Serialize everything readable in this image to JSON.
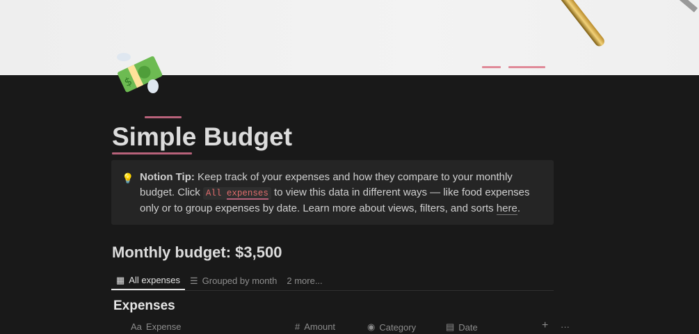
{
  "page": {
    "title": "Simple Budget",
    "icon": "money-with-wings-icon"
  },
  "callout": {
    "icon": "lightbulb-icon",
    "bold": "Notion Tip:",
    "text1": " Keep track of your expenses and how they compare to your monthly budget. Click ",
    "code_a": "All",
    "code_b": "expenses",
    "text2": " to view this data in different ways — like food expenses only or to group expenses by date. Learn more about views, filters, and sorts ",
    "link": "here",
    "text3": "."
  },
  "budget_heading": "Monthly budget: $3,500",
  "tabs": [
    {
      "label": "All expenses",
      "icon": "table-icon"
    },
    {
      "label": "Grouped by month",
      "icon": "list-icon"
    },
    {
      "label": "2 more..."
    }
  ],
  "database": {
    "title": "Expenses",
    "columns": [
      {
        "label": "Expense",
        "icon": "Aa"
      },
      {
        "label": "Amount",
        "icon": "#"
      },
      {
        "label": "Category",
        "icon": "select-icon"
      },
      {
        "label": "Date",
        "icon": "calendar-icon"
      }
    ],
    "add": "+",
    "more": "···"
  }
}
